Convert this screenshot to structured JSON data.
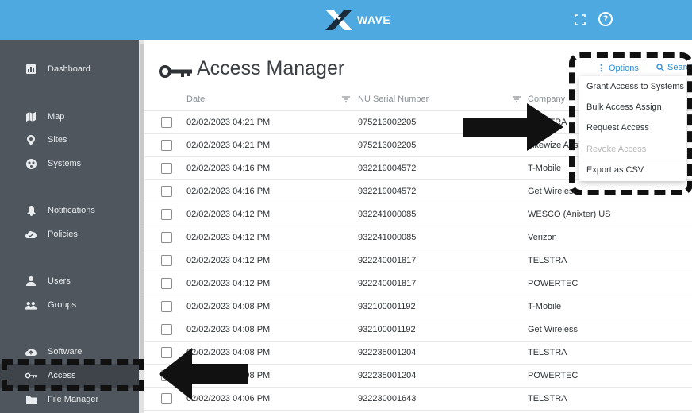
{
  "app": {
    "logo_text": "WAVE"
  },
  "sidebar": {
    "items": [
      {
        "label": "Dashboard",
        "icon": "dashboard-icon"
      },
      {
        "label": "Map",
        "icon": "map-icon"
      },
      {
        "label": "Sites",
        "icon": "location-pin-icon"
      },
      {
        "label": "Systems",
        "icon": "systems-icon"
      },
      {
        "label": "Notifications",
        "icon": "bell-icon"
      },
      {
        "label": "Policies",
        "icon": "cloud-check-icon"
      },
      {
        "label": "Users",
        "icon": "user-icon"
      },
      {
        "label": "Groups",
        "icon": "group-icon"
      },
      {
        "label": "Software",
        "icon": "cloud-upload-icon"
      },
      {
        "label": "Access",
        "icon": "key-icon"
      },
      {
        "label": "File Manager",
        "icon": "folder-icon"
      }
    ]
  },
  "page": {
    "title": "Access Manager"
  },
  "toolbar": {
    "options_label": "Options",
    "search_label": "Search"
  },
  "table": {
    "columns": [
      "Date",
      "NU Serial Number",
      "Company"
    ],
    "rows": [
      {
        "date": "02/02/2023 04:21 PM",
        "serial": "975213002205",
        "company": "TELSTRA"
      },
      {
        "date": "02/02/2023 04:21 PM",
        "serial": "975213002205",
        "company": "Likewize Australia"
      },
      {
        "date": "02/02/2023 04:16 PM",
        "serial": "932219004572",
        "company": "T-Mobile"
      },
      {
        "date": "02/02/2023 04:16 PM",
        "serial": "932219004572",
        "company": "Get Wireless"
      },
      {
        "date": "02/02/2023 04:12 PM",
        "serial": "932241000085",
        "company": "WESCO (Anixter) US"
      },
      {
        "date": "02/02/2023 04:12 PM",
        "serial": "932241000085",
        "company": "Verizon"
      },
      {
        "date": "02/02/2023 04:12 PM",
        "serial": "922240001817",
        "company": "TELSTRA"
      },
      {
        "date": "02/02/2023 04:12 PM",
        "serial": "922240001817",
        "company": "POWERTEC"
      },
      {
        "date": "02/02/2023 04:08 PM",
        "serial": "932100001192",
        "company": "T-Mobile"
      },
      {
        "date": "02/02/2023 04:08 PM",
        "serial": "932100001192",
        "company": "Get Wireless"
      },
      {
        "date": "02/02/2023 04:08 PM",
        "serial": "922235001204",
        "company": "TELSTRA"
      },
      {
        "date": "02/02/2023 04:08 PM",
        "serial": "922235001204",
        "company": "POWERTEC"
      },
      {
        "date": "02/02/2023 04:06 PM",
        "serial": "922230001643",
        "company": "TELSTRA"
      }
    ]
  },
  "options_menu": {
    "items": [
      {
        "label": "Grant Access to Systems",
        "disabled": false
      },
      {
        "label": "Bulk Access Assign",
        "disabled": false
      },
      {
        "label": "Request Access",
        "disabled": false
      },
      {
        "label": "Revoke Access",
        "disabled": true
      },
      {
        "label": "Export as CSV",
        "disabled": false
      }
    ]
  },
  "colors": {
    "header": "#4ea9e0",
    "sidebar": "#4f565e",
    "accent": "#2f8fd6"
  }
}
